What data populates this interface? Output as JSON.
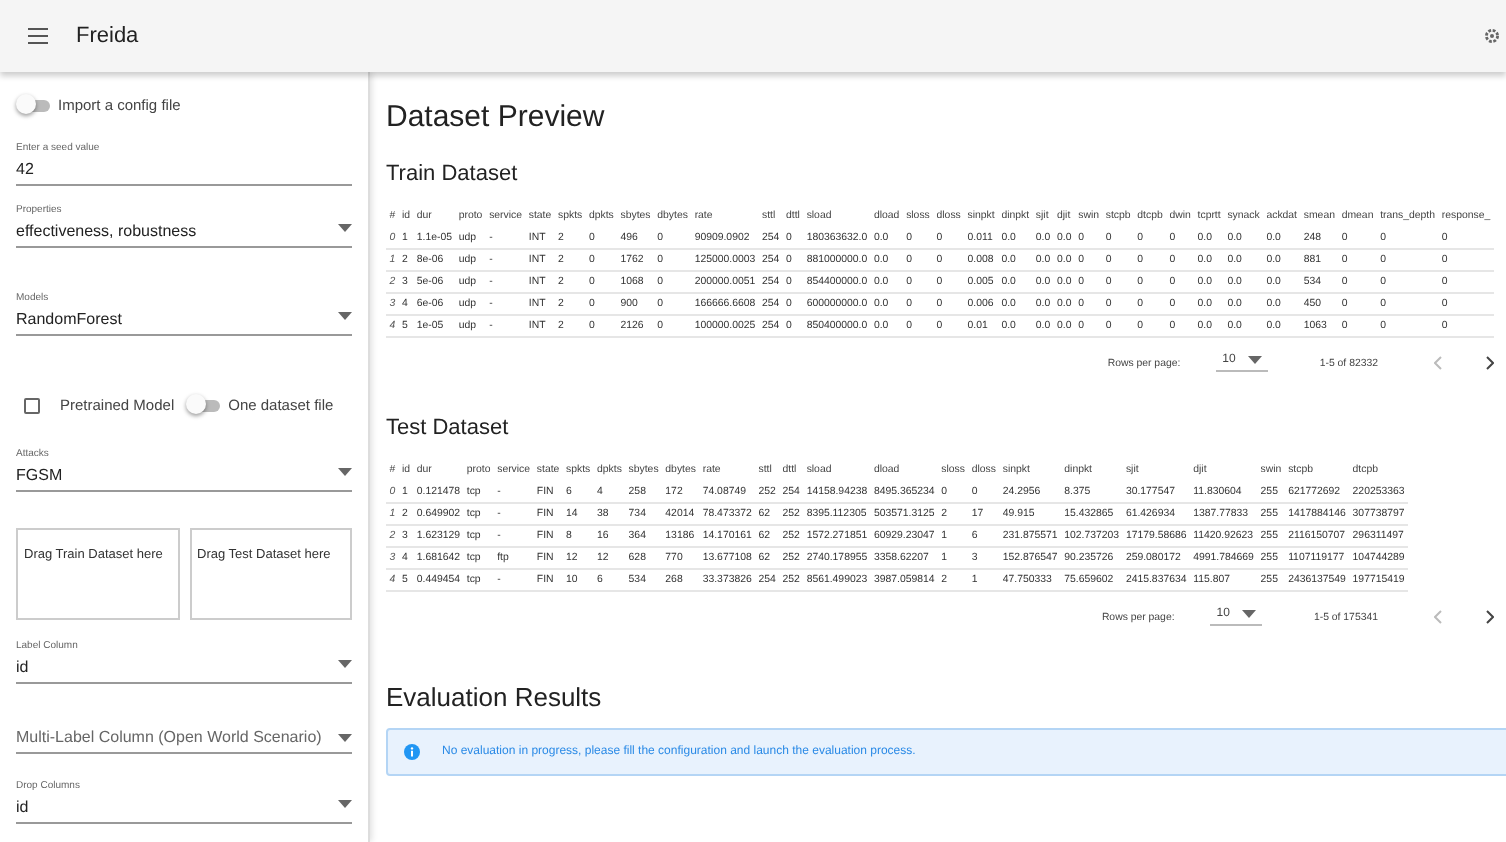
{
  "app_bar": {
    "title": "Freida"
  },
  "sidebar": {
    "import_config": {
      "label": "Import a config file",
      "on": false
    },
    "seed": {
      "label": "Enter a seed value",
      "value": "42"
    },
    "properties": {
      "label": "Properties",
      "value": "effectiveness, robustness"
    },
    "models": {
      "label": "Models",
      "value": "RandomForest"
    },
    "pretrained": {
      "label": "Pretrained Model",
      "checked": false
    },
    "one_dataset": {
      "label": "One dataset file",
      "on": false
    },
    "attacks": {
      "label": "Attacks",
      "value": "FGSM"
    },
    "dropzones": [
      "Drag Train Dataset here",
      "Drag Test Dataset here"
    ],
    "label_column": {
      "label": "Label Column",
      "value": "id"
    },
    "multi_label": {
      "placeholder": "Multi-Label Column (Open World Scenario)"
    },
    "drop_columns": {
      "label": "Drop Columns",
      "value": "id"
    }
  },
  "main": {
    "title": "Dataset Preview",
    "train": {
      "title": "Train Dataset",
      "columns": [
        "#",
        "id",
        "dur",
        "proto",
        "service",
        "state",
        "spkts",
        "dpkts",
        "sbytes",
        "dbytes",
        "rate",
        "sttl",
        "dttl",
        "sload",
        "dload",
        "sloss",
        "dloss",
        "sinpkt",
        "dinpkt",
        "sjit",
        "djit",
        "swin",
        "stcpb",
        "dtcpb",
        "dwin",
        "tcprtt",
        "synack",
        "ackdat",
        "smean",
        "dmean",
        "trans_depth",
        "response_"
      ],
      "rows": [
        [
          "0",
          "1",
          "1.1e-05",
          "udp",
          "-",
          "INT",
          "2",
          "0",
          "496",
          "0",
          "90909.0902",
          "254",
          "0",
          "180363632.0",
          "0.0",
          "0",
          "0",
          "0.011",
          "0.0",
          "0.0",
          "0.0",
          "0",
          "0",
          "0",
          "0",
          "0.0",
          "0.0",
          "0.0",
          "248",
          "0",
          "0",
          "0"
        ],
        [
          "1",
          "2",
          "8e-06",
          "udp",
          "-",
          "INT",
          "2",
          "0",
          "1762",
          "0",
          "125000.0003",
          "254",
          "0",
          "881000000.0",
          "0.0",
          "0",
          "0",
          "0.008",
          "0.0",
          "0.0",
          "0.0",
          "0",
          "0",
          "0",
          "0",
          "0.0",
          "0.0",
          "0.0",
          "881",
          "0",
          "0",
          "0"
        ],
        [
          "2",
          "3",
          "5e-06",
          "udp",
          "-",
          "INT",
          "2",
          "0",
          "1068",
          "0",
          "200000.0051",
          "254",
          "0",
          "854400000.0",
          "0.0",
          "0",
          "0",
          "0.005",
          "0.0",
          "0.0",
          "0.0",
          "0",
          "0",
          "0",
          "0",
          "0.0",
          "0.0",
          "0.0",
          "534",
          "0",
          "0",
          "0"
        ],
        [
          "3",
          "4",
          "6e-06",
          "udp",
          "-",
          "INT",
          "2",
          "0",
          "900",
          "0",
          "166666.6608",
          "254",
          "0",
          "600000000.0",
          "0.0",
          "0",
          "0",
          "0.006",
          "0.0",
          "0.0",
          "0.0",
          "0",
          "0",
          "0",
          "0",
          "0.0",
          "0.0",
          "0.0",
          "450",
          "0",
          "0",
          "0"
        ],
        [
          "4",
          "5",
          "1e-05",
          "udp",
          "-",
          "INT",
          "2",
          "0",
          "2126",
          "0",
          "100000.0025",
          "254",
          "0",
          "850400000.0",
          "0.0",
          "0",
          "0",
          "0.01",
          "0.0",
          "0.0",
          "0.0",
          "0",
          "0",
          "0",
          "0",
          "0.0",
          "0.0",
          "0.0",
          "1063",
          "0",
          "0",
          "0"
        ]
      ],
      "pagination": {
        "label": "Rows per page:",
        "rows_per_page": "10",
        "range": "1-5 of 82332"
      }
    },
    "test": {
      "title": "Test Dataset",
      "columns": [
        "#",
        "id",
        "dur",
        "proto",
        "service",
        "state",
        "spkts",
        "dpkts",
        "sbytes",
        "dbytes",
        "rate",
        "sttl",
        "dttl",
        "sload",
        "dload",
        "sloss",
        "dloss",
        "sinpkt",
        "dinpkt",
        "sjit",
        "djit",
        "swin",
        "stcpb",
        "dtcpb"
      ],
      "rows": [
        [
          "0",
          "1",
          "0.121478",
          "tcp",
          "-",
          "FIN",
          "6",
          "4",
          "258",
          "172",
          "74.08749",
          "252",
          "254",
          "14158.94238",
          "8495.365234",
          "0",
          "0",
          "24.2956",
          "8.375",
          "30.177547",
          "11.830604",
          "255",
          "621772692",
          "220253363"
        ],
        [
          "1",
          "2",
          "0.649902",
          "tcp",
          "-",
          "FIN",
          "14",
          "38",
          "734",
          "42014",
          "78.473372",
          "62",
          "252",
          "8395.112305",
          "503571.3125",
          "2",
          "17",
          "49.915",
          "15.432865",
          "61.426934",
          "1387.77833",
          "255",
          "1417884146",
          "307738797"
        ],
        [
          "2",
          "3",
          "1.623129",
          "tcp",
          "-",
          "FIN",
          "8",
          "16",
          "364",
          "13186",
          "14.170161",
          "62",
          "252",
          "1572.271851",
          "60929.23047",
          "1",
          "6",
          "231.875571",
          "102.737203",
          "17179.58686",
          "11420.92623",
          "255",
          "2116150707",
          "296311497"
        ],
        [
          "3",
          "4",
          "1.681642",
          "tcp",
          "ftp",
          "FIN",
          "12",
          "12",
          "628",
          "770",
          "13.677108",
          "62",
          "252",
          "2740.178955",
          "3358.62207",
          "1",
          "3",
          "152.876547",
          "90.235726",
          "259.080172",
          "4991.784669",
          "255",
          "1107119177",
          "104744289"
        ],
        [
          "4",
          "5",
          "0.449454",
          "tcp",
          "-",
          "FIN",
          "10",
          "6",
          "534",
          "268",
          "33.373826",
          "254",
          "252",
          "8561.499023",
          "3987.059814",
          "2",
          "1",
          "47.750333",
          "75.659602",
          "2415.837634",
          "115.807",
          "255",
          "2436137549",
          "197715419"
        ]
      ],
      "pagination": {
        "label": "Rows per page:",
        "rows_per_page": "10",
        "range": "1-5 of 175341"
      }
    },
    "evaluation": {
      "title": "Evaluation Results",
      "alert": "No evaluation in progress, please fill the configuration and launch the evaluation process."
    }
  }
}
